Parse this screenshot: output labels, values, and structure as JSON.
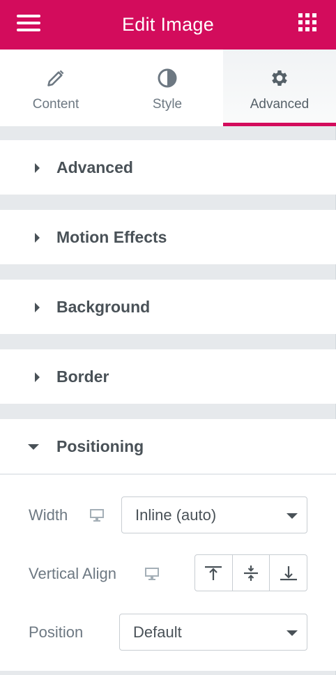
{
  "header": {
    "title": "Edit Image",
    "menu_icon": "hamburger-menu-icon",
    "apps_icon": "grid-apps-icon",
    "color": "#d30c5c"
  },
  "tabs": [
    {
      "label": "Content",
      "icon": "pencil-icon",
      "active": false
    },
    {
      "label": "Style",
      "icon": "half-circle-contrast-icon",
      "active": false
    },
    {
      "label": "Advanced",
      "icon": "gear-icon",
      "active": true
    }
  ],
  "sections": [
    {
      "label": "Advanced",
      "expanded": false
    },
    {
      "label": "Motion Effects",
      "expanded": false
    },
    {
      "label": "Background",
      "expanded": false
    },
    {
      "label": "Border",
      "expanded": false
    },
    {
      "label": "Positioning",
      "expanded": true
    }
  ],
  "positioning": {
    "width": {
      "label": "Width",
      "value": "Inline (auto)",
      "device_icon": "desktop-monitor-icon"
    },
    "vertical_align": {
      "label": "Vertical Align",
      "device_icon": "desktop-monitor-icon",
      "options": [
        "align-top-icon",
        "align-middle-icon",
        "align-bottom-icon"
      ]
    },
    "position": {
      "label": "Position",
      "value": "Default"
    }
  }
}
